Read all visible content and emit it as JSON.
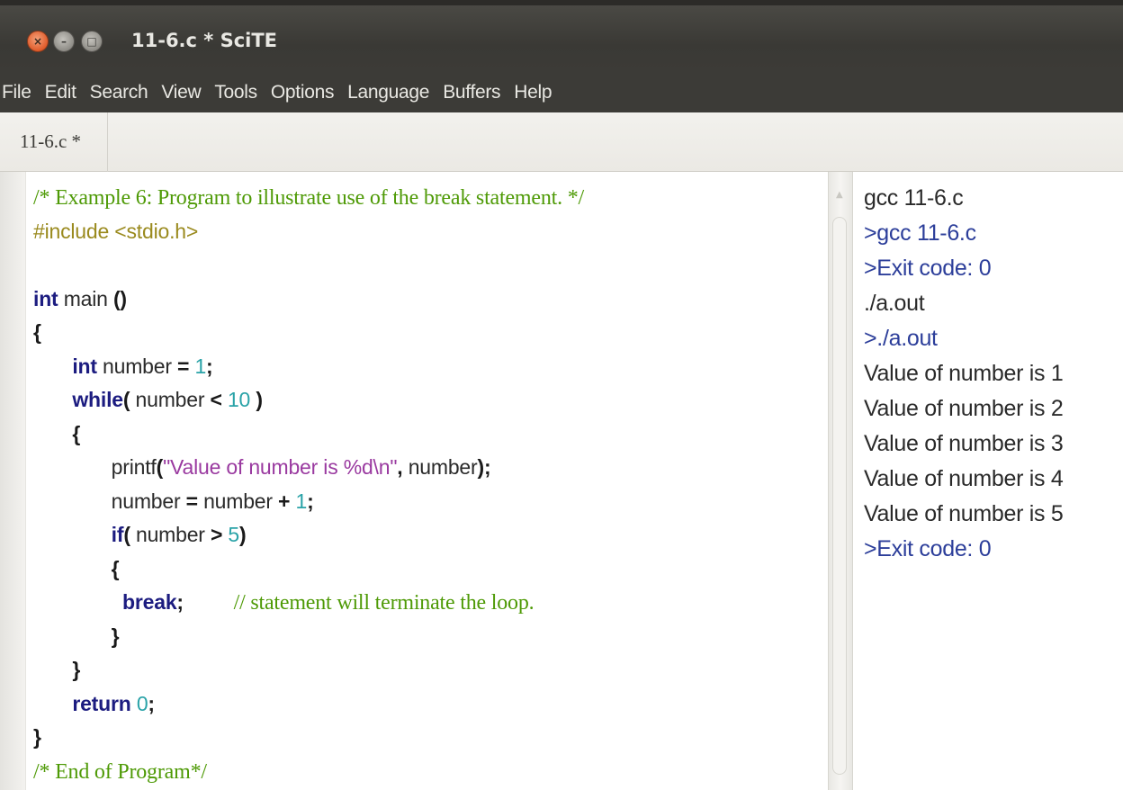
{
  "window": {
    "title": "11-6.c * SciTE",
    "close_glyph": "×",
    "min_glyph": "–",
    "max_glyph": "□"
  },
  "menu": {
    "items": [
      "File",
      "Edit",
      "Search",
      "View",
      "Tools",
      "Options",
      "Language",
      "Buffers",
      "Help"
    ]
  },
  "tabs": [
    {
      "label": "11-6.c *",
      "active": true
    }
  ],
  "editor": {
    "lines": [
      [
        {
          "t": "/* Example 6: Program to illustrate use of the break statement. */",
          "c": "cmt"
        }
      ],
      [
        {
          "t": "#include <stdio.h>",
          "c": "pp"
        }
      ],
      [],
      [
        {
          "t": "int",
          "c": "kw"
        },
        {
          "t": " main ",
          "c": ""
        },
        {
          "t": "()",
          "c": "op"
        }
      ],
      [
        {
          "t": "{",
          "c": "op"
        }
      ],
      [
        {
          "t": "       ",
          "c": ""
        },
        {
          "t": "int",
          "c": "kw"
        },
        {
          "t": " number ",
          "c": ""
        },
        {
          "t": "=",
          "c": "op"
        },
        {
          "t": " ",
          "c": ""
        },
        {
          "t": "1",
          "c": "num"
        },
        {
          "t": ";",
          "c": "op"
        }
      ],
      [
        {
          "t": "       ",
          "c": ""
        },
        {
          "t": "while",
          "c": "kw"
        },
        {
          "t": "(",
          "c": "op"
        },
        {
          "t": " number ",
          "c": ""
        },
        {
          "t": "<",
          "c": "op"
        },
        {
          "t": " ",
          "c": ""
        },
        {
          "t": "10",
          "c": "num"
        },
        {
          "t": " )",
          "c": "op"
        }
      ],
      [
        {
          "t": "       ",
          "c": ""
        },
        {
          "t": "{",
          "c": "op"
        }
      ],
      [
        {
          "t": "              printf",
          "c": ""
        },
        {
          "t": "(",
          "c": "op"
        },
        {
          "t": "\"Value of number is %d\\n\"",
          "c": "str"
        },
        {
          "t": ",",
          "c": "op"
        },
        {
          "t": " number",
          "c": ""
        },
        {
          "t": ");",
          "c": "op"
        }
      ],
      [
        {
          "t": "              number ",
          "c": ""
        },
        {
          "t": "=",
          "c": "op"
        },
        {
          "t": " number ",
          "c": ""
        },
        {
          "t": "+",
          "c": "op"
        },
        {
          "t": " ",
          "c": ""
        },
        {
          "t": "1",
          "c": "num"
        },
        {
          "t": ";",
          "c": "op"
        }
      ],
      [
        {
          "t": "              ",
          "c": ""
        },
        {
          "t": "if",
          "c": "kw"
        },
        {
          "t": "(",
          "c": "op"
        },
        {
          "t": " number ",
          "c": ""
        },
        {
          "t": ">",
          "c": "op"
        },
        {
          "t": " ",
          "c": ""
        },
        {
          "t": "5",
          "c": "num"
        },
        {
          "t": ")",
          "c": "op"
        }
      ],
      [
        {
          "t": "              ",
          "c": ""
        },
        {
          "t": "{",
          "c": "op"
        }
      ],
      [
        {
          "t": "                ",
          "c": ""
        },
        {
          "t": "break",
          "c": "kw"
        },
        {
          "t": ";",
          "c": "op"
        },
        {
          "t": "         ",
          "c": ""
        },
        {
          "t": "// statement will terminate the loop.",
          "c": "cmt"
        }
      ],
      [
        {
          "t": "              ",
          "c": ""
        },
        {
          "t": "}",
          "c": "op"
        }
      ],
      [
        {
          "t": "       ",
          "c": ""
        },
        {
          "t": "}",
          "c": "op"
        }
      ],
      [
        {
          "t": "       ",
          "c": ""
        },
        {
          "t": "return",
          "c": "kw"
        },
        {
          "t": " ",
          "c": ""
        },
        {
          "t": "0",
          "c": "num"
        },
        {
          "t": ";",
          "c": "op"
        }
      ],
      [
        {
          "t": "}",
          "c": "op"
        }
      ],
      [
        {
          "t": "/* End of Program*/",
          "c": "cmt"
        }
      ]
    ]
  },
  "output": {
    "lines": [
      {
        "text": "gcc 11-6.c",
        "kind": "plain"
      },
      {
        "text": ">gcc 11-6.c",
        "kind": "tool"
      },
      {
        "text": ">Exit code: 0",
        "kind": "tool"
      },
      {
        "text": "./a.out",
        "kind": "plain"
      },
      {
        "text": ">./a.out",
        "kind": "tool"
      },
      {
        "text": "Value of number is 1",
        "kind": "plain"
      },
      {
        "text": "Value of number is 2",
        "kind": "plain"
      },
      {
        "text": "Value of number is 3",
        "kind": "plain"
      },
      {
        "text": "Value of number is 4",
        "kind": "plain"
      },
      {
        "text": "Value of number is 5",
        "kind": "plain"
      },
      {
        "text": ">Exit code: 0",
        "kind": "tool"
      }
    ]
  },
  "colors": {
    "comment": "#4e9a06",
    "preprocessor": "#9a8a1e",
    "keyword": "#1c1c80",
    "number": "#2aa3a8",
    "string": "#9a3aa0",
    "output_tool": "#2c3e9a",
    "titlebar": "#3c3b37"
  }
}
